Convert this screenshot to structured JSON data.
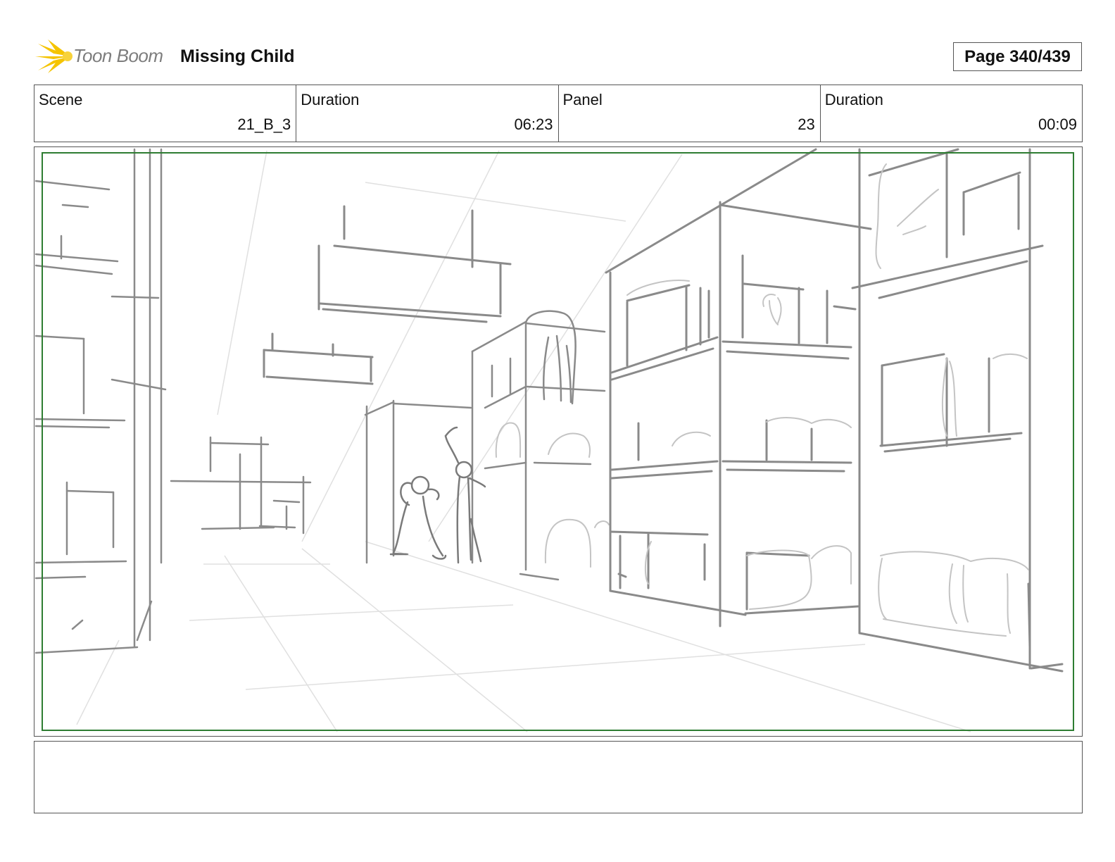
{
  "header": {
    "logo_text": "Toon Boom",
    "project_title": "Missing Child",
    "page_label": "Page 340/439"
  },
  "info": [
    {
      "label": "Scene",
      "value": "21_B_3"
    },
    {
      "label": "Duration",
      "value": "06:23"
    },
    {
      "label": "Panel",
      "value": "23"
    },
    {
      "label": "Duration",
      "value": "00:09"
    }
  ],
  "notes": {
    "text": ""
  },
  "colors": {
    "safe_area_border": "#2e7d32",
    "logo_accent": "#f5c400",
    "sketch_line": "#8a8a8a"
  }
}
